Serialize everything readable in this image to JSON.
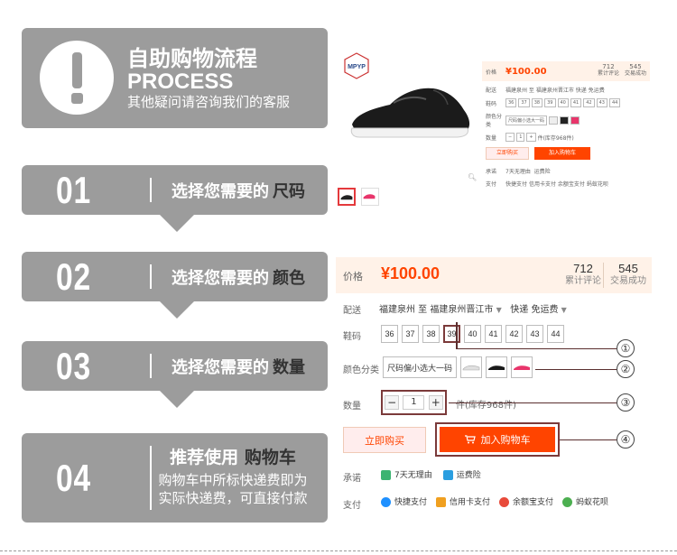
{
  "process": {
    "title": "自助购物流程",
    "title_en": "PROCESS",
    "subtitle": "其他疑问请咨询我们的客服"
  },
  "steps": [
    {
      "num": "01",
      "text": "选择您需要的",
      "keyword": "尺码"
    },
    {
      "num": "02",
      "text": "选择您需要的",
      "keyword": "颜色"
    },
    {
      "num": "03",
      "text": "选择您需要的",
      "keyword": "数量"
    },
    {
      "num": "04",
      "text": "推荐使用",
      "keyword": "购物车",
      "desc1": "购物车中所标快递费即为",
      "desc2": "实际快递费，可直接付款"
    }
  ],
  "product": {
    "brand": "MPYP",
    "price_label": "价格",
    "price": "¥100.00",
    "reviews_count": "712",
    "reviews_label": "累计评论",
    "sales_count": "545",
    "sales_label": "交易成功",
    "delivery_label": "配送",
    "origin": "福建泉州 至",
    "destination": "福建泉州晋江市",
    "shipping": "快递 免运费",
    "size_label": "鞋码",
    "sizes": [
      "36",
      "37",
      "38",
      "39",
      "40",
      "41",
      "42",
      "43",
      "44"
    ],
    "selected_size": "39",
    "color_label": "颜色分类",
    "color_option_text": "尺码偏小选大一码",
    "quantity_label": "数量",
    "quantity": "1",
    "stock_text": "件(库存968件)",
    "buy_now": "立即购买",
    "add_to_cart": "加入购物车",
    "promise_label": "承诺",
    "promises": [
      "7天无理由",
      "运费险"
    ],
    "payment_label": "支付",
    "payments": [
      "快捷支付",
      "信用卡支付",
      "余额宝支付",
      "蚂蚁花呗"
    ]
  },
  "callouts": [
    "①",
    "②",
    "③",
    "④"
  ],
  "colors": {
    "panel_grey": "#9c9c9c",
    "price_orange": "#ff4400",
    "highlight_border": "#7b3a3a",
    "price_bg": "#fff2e8"
  }
}
